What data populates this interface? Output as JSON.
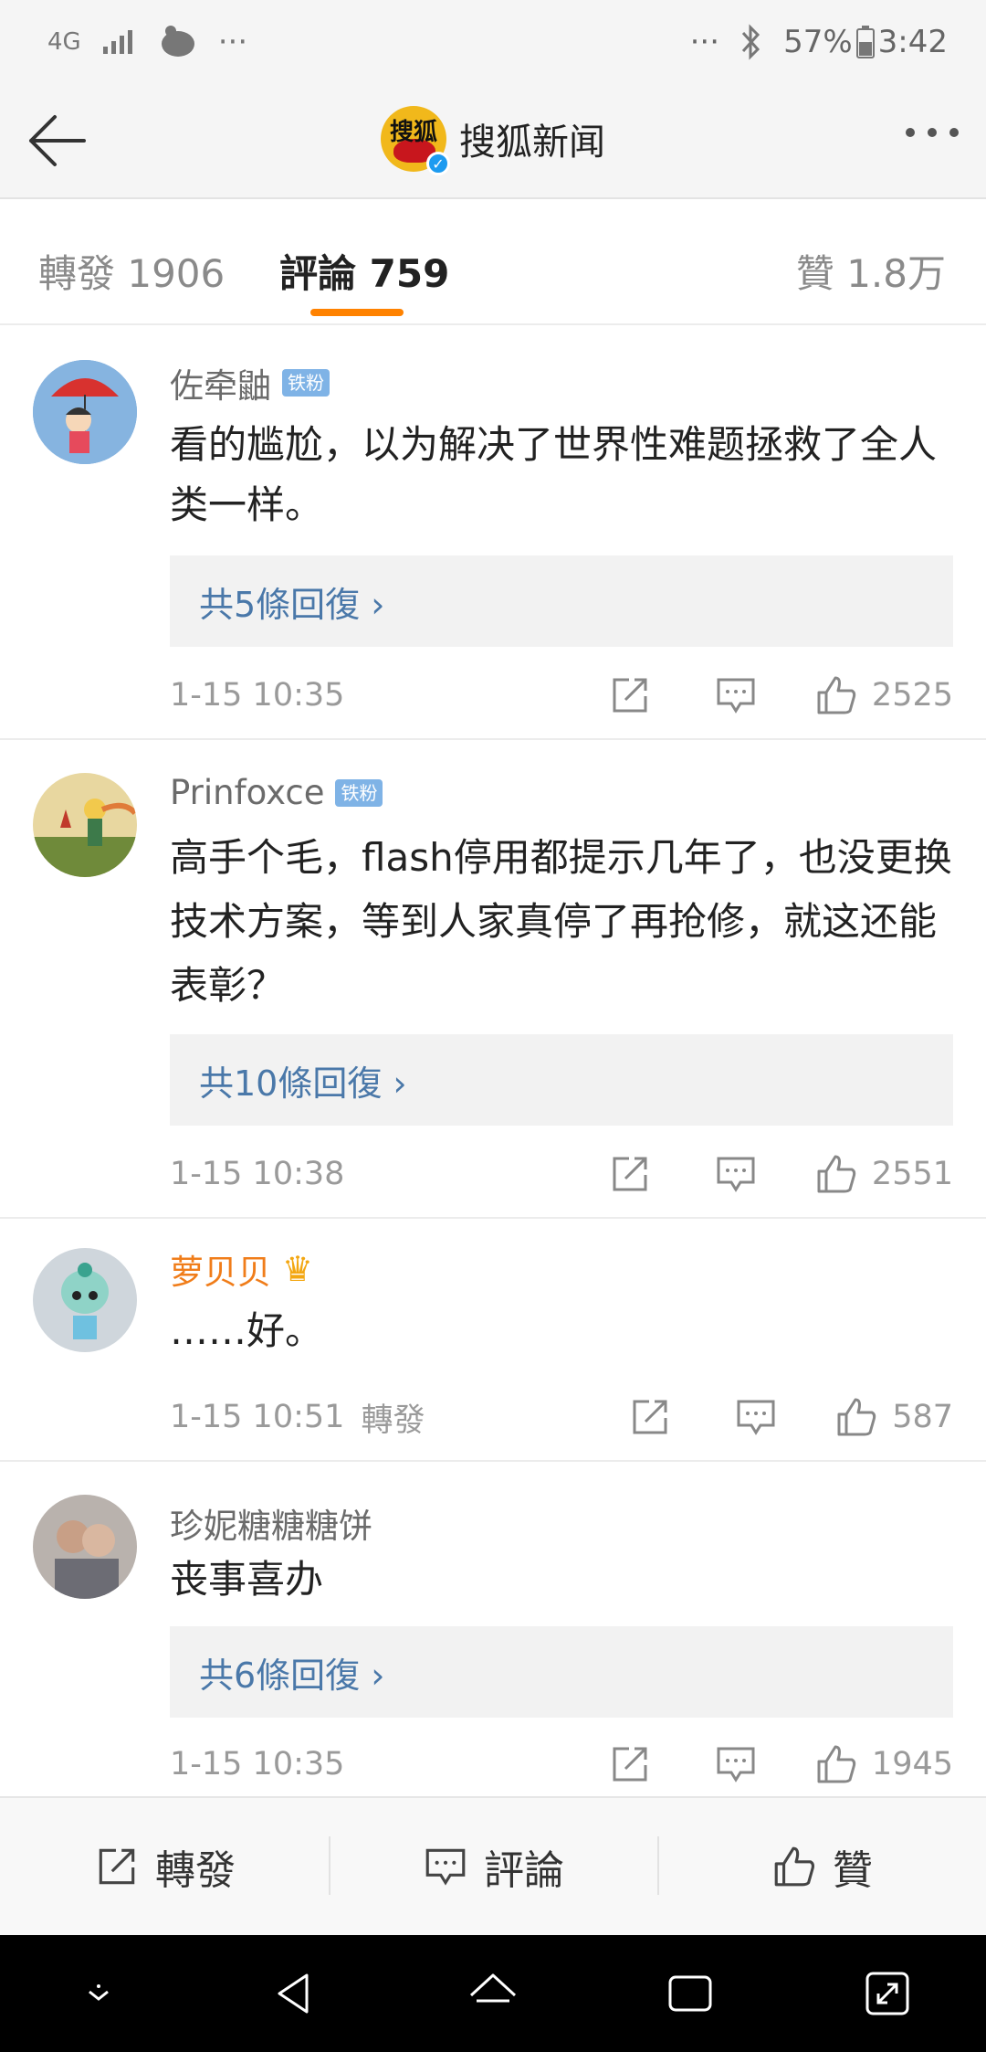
{
  "status_bar": {
    "network": "4G",
    "more_left": "···",
    "more_right": "···",
    "battery": "57%",
    "time": "3:42"
  },
  "header": {
    "title": "搜狐新闻",
    "logo_text": "搜狐"
  },
  "tabs": [
    {
      "label": "轉發 1906"
    },
    {
      "label": "評論 759"
    },
    {
      "label": "贊 1.8万"
    }
  ],
  "comments": [
    {
      "user": "佐牵鼬",
      "badge": "铁粉",
      "text": "看的尴尬，以为解决了世界性难题拯救了全人类一样。",
      "replies": "共5條回復 ›",
      "time": "1-15 10:35",
      "extra": "",
      "likes": "2525"
    },
    {
      "user": "Prinfoxce",
      "badge": "铁粉",
      "text": "高手个毛，flash停用都提示几年了，也没更换技术方案，等到人家真停了再抢修，就这还能表彰？",
      "replies": "共10條回復 ›",
      "time": "1-15 10:38",
      "extra": "",
      "likes": "2551"
    },
    {
      "user": "萝贝贝",
      "badge": "",
      "text": "……好。",
      "replies": "",
      "time": "1-15 10:51",
      "extra": "轉發",
      "likes": "587"
    },
    {
      "user": "珍妮糖糖糖饼",
      "badge": "",
      "text": "丧事喜办",
      "replies": "共6條回復 ›",
      "time": "1-15 10:35",
      "extra": "",
      "likes": "1945"
    }
  ],
  "bottom_bar": {
    "repost": "轉發",
    "comment": "評論",
    "like": "贊"
  },
  "colors": {
    "accent": "#ff8200",
    "link": "#4a78a9",
    "vip_name": "#f07d1a"
  }
}
